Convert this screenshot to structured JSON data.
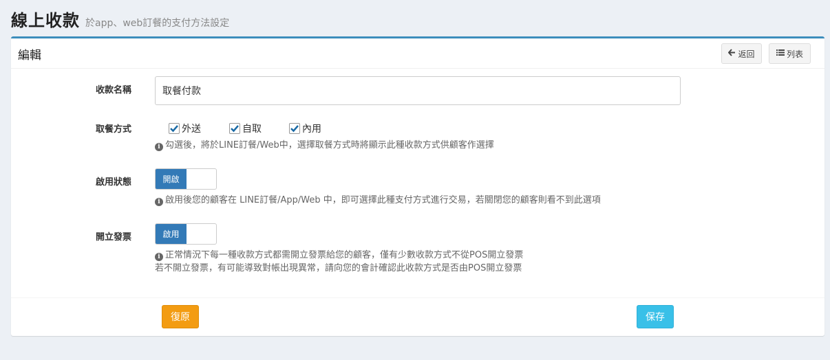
{
  "header": {
    "title": "線上收款",
    "subtitle": "於app、web訂餐的支付方法設定"
  },
  "box": {
    "title": "編輯",
    "back_label": "返回",
    "list_label": "列表"
  },
  "form": {
    "name": {
      "label": "收款名稱",
      "value": "取餐付款"
    },
    "pickup": {
      "label": "取餐方式",
      "options": [
        {
          "label": "外送",
          "checked": true
        },
        {
          "label": "自取",
          "checked": true
        },
        {
          "label": "內用",
          "checked": true
        }
      ],
      "help": "勾選後，將於LINE訂餐/Web中，選擇取餐方式時將顯示此種收款方式供顧客作選擇"
    },
    "status": {
      "label": "啟用狀態",
      "toggle_label": "開啟",
      "help": "啟用後您的顧客在 LINE訂餐/App/Web 中，即可選擇此種支付方式進行交易，若關閉您的顧客則看不到此選項"
    },
    "invoice": {
      "label": "開立發票",
      "toggle_label": "啟用",
      "help_line1": "正常情況下每一種收款方式都需開立發票給您的顧客，僅有少數收款方式不從POS開立發票",
      "help_line2": "若不開立發票，有可能導致對帳出現異常，請向您的會計確認此收款方式是否由POS開立發票"
    }
  },
  "footer": {
    "reset_label": "復原",
    "save_label": "保存"
  },
  "colors": {
    "primary": "#3c8dbc",
    "toggle_on": "#337ab7",
    "warning": "#f39c12",
    "info": "#39c0e8"
  }
}
